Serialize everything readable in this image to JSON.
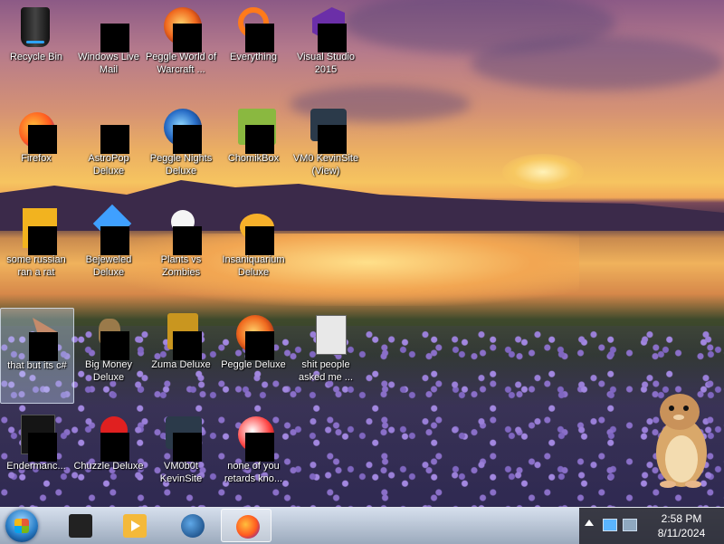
{
  "desktop": {
    "icons": [
      {
        "label": "Recycle Bin",
        "icon": "recycle-bin-icon",
        "censored": false
      },
      {
        "label": "Windows Live Mail",
        "icon": "windows-live-mail-icon",
        "censored": true
      },
      {
        "label": "Peggle World of Warcraft ...",
        "icon": "peggle-wow-icon",
        "censored": true
      },
      {
        "label": "Everything",
        "icon": "everything-icon",
        "censored": true
      },
      {
        "label": "Visual Studio 2015",
        "icon": "visual-studio-icon",
        "censored": true
      },
      {
        "label": "Firefox",
        "icon": "firefox-icon",
        "censored": true
      },
      {
        "label": "AstroPop Deluxe",
        "icon": "astropop-icon",
        "censored": true
      },
      {
        "label": "Peggle Nights Deluxe",
        "icon": "peggle-nights-icon",
        "censored": true
      },
      {
        "label": "ChomikBox",
        "icon": "chomikbox-icon",
        "censored": true
      },
      {
        "label": "VM0 KevinSite (View)",
        "icon": "vm-view-icon",
        "censored": true
      },
      {
        "label": "some russian ran a rat",
        "icon": "script-file-icon",
        "censored": true
      },
      {
        "label": "Bejeweled Deluxe",
        "icon": "bejeweled-icon",
        "censored": true
      },
      {
        "label": "Plants vs Zombies",
        "icon": "plants-vs-zombies-icon",
        "censored": true
      },
      {
        "label": "Insaniquarium Deluxe",
        "icon": "insaniquarium-icon",
        "censored": true
      },
      {
        "label": "that but its c#",
        "icon": "shortcut-cursor-icon",
        "censored": true
      },
      {
        "label": "Big Money Deluxe",
        "icon": "big-money-icon",
        "censored": true
      },
      {
        "label": "Zuma Deluxe",
        "icon": "zuma-icon",
        "censored": true
      },
      {
        "label": "Peggle Deluxe",
        "icon": "peggle-icon",
        "censored": true
      },
      {
        "label": "shit people asked me ...",
        "icon": "folder-icon",
        "censored": false
      },
      {
        "label": "Endermanc...",
        "icon": "endermanch-icon",
        "censored": true
      },
      {
        "label": "Chuzzle Deluxe",
        "icon": "chuzzle-icon",
        "censored": true
      },
      {
        "label": "VM0b0t KevinSite",
        "icon": "vm-icon",
        "censored": true
      },
      {
        "label": "none of you retards kno...",
        "icon": "app-ball-icon",
        "censored": true
      }
    ]
  },
  "taskbar": {
    "start_icon": "windows-start-orb-icon",
    "pinned": [
      {
        "icon": "virtual-pc-icon",
        "active": false
      },
      {
        "icon": "media-player-icon",
        "active": false
      },
      {
        "icon": "globe-icon",
        "active": false
      },
      {
        "icon": "firefox-icon",
        "active": true
      }
    ],
    "tray": {
      "time": "2:58 PM",
      "date": "8/11/2024"
    }
  },
  "colors": {
    "taskbar": "#a8b6c8",
    "tray": "#2a2a32",
    "label_text": "#ffffff"
  }
}
